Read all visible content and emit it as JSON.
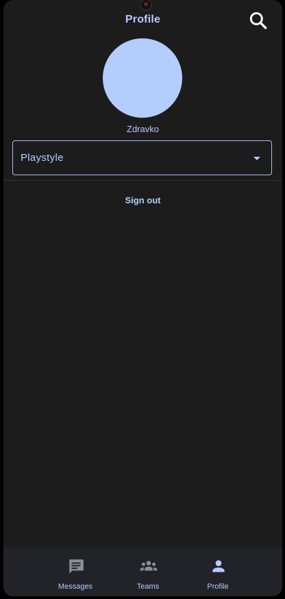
{
  "header": {
    "title": "Profile",
    "search_icon": "search-icon"
  },
  "profile": {
    "username": "Zdravko",
    "avatar_color": "#b3cdfc"
  },
  "playstyle_select": {
    "selected": "Playstyle",
    "icon": "dropdown-arrow-icon"
  },
  "actions": {
    "sign_out": "Sign out"
  },
  "bottom_nav": {
    "items": [
      {
        "label": "Messages",
        "icon": "message-icon",
        "active": false
      },
      {
        "label": "Teams",
        "icon": "group-icon",
        "active": false
      },
      {
        "label": "Profile",
        "icon": "person-icon",
        "active": true
      }
    ]
  },
  "colors": {
    "accent": "#b5ccff",
    "background": "#1c1c1d",
    "nav_background": "#222229",
    "inactive_icon": "#8e8e93"
  }
}
